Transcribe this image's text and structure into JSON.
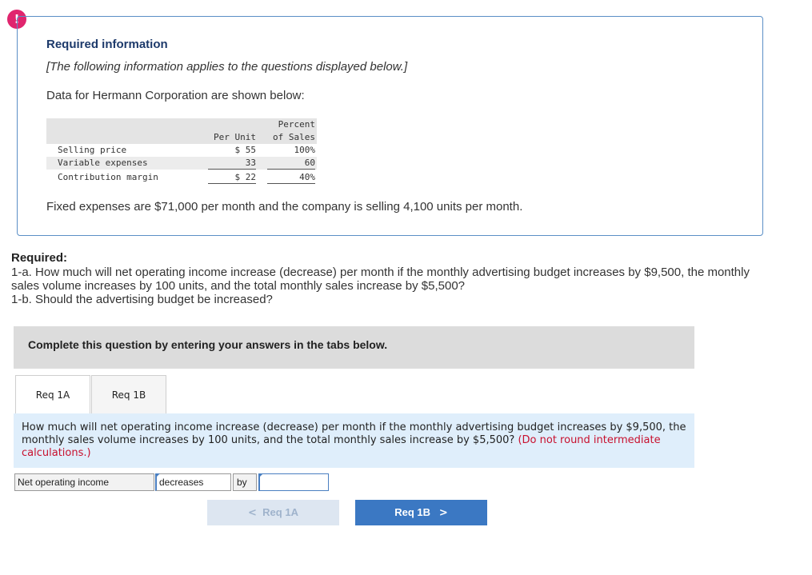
{
  "alert": {
    "symbol": "!"
  },
  "info": {
    "title": "Required information",
    "note": "[The following information applies to the questions displayed below.]",
    "intro": "Data for Hermann Corporation are shown below:",
    "fixed": "Fixed expenses are $71,000 per month and the company is selling 4,100 units per month."
  },
  "table": {
    "header_pu": "Per Unit",
    "header_pct_1": "Percent",
    "header_pct_2": "of Sales",
    "rows": [
      {
        "label": "Selling price",
        "per_unit": "$ 55",
        "percent": "100%"
      },
      {
        "label": "Variable expenses",
        "per_unit": "33",
        "percent": "60"
      },
      {
        "label": "Contribution margin",
        "per_unit": "$ 22",
        "percent": "40%"
      }
    ]
  },
  "required": {
    "heading": "Required:",
    "line1": "1-a. How much will net operating income increase (decrease) per month if the monthly advertising budget increases by $9,500, the monthly sales volume increases by 100 units, and the total monthly sales increase by $5,500?",
    "line2": "1-b. Should the advertising budget be increased?"
  },
  "complete": {
    "text": "Complete this question by entering your answers in the tabs below."
  },
  "tabs": [
    {
      "label": "Req 1A"
    },
    {
      "label": "Req 1B"
    }
  ],
  "question": {
    "text": "How much will net operating income increase (decrease) per month if the monthly advertising budget increases by $9,500, the monthly sales volume increases by 100 units, and the total monthly sales increase by $5,500?",
    "note": "(Do not round intermediate calculations.)"
  },
  "answer": {
    "label": "Net operating income",
    "direction": "decreases",
    "by": "by",
    "value": ""
  },
  "nav": {
    "prev_label": "Req 1A",
    "next_label": "Req 1B",
    "prev_glyph": "<",
    "next_glyph": ">"
  },
  "colors": {
    "accent": "#3b78c3",
    "alert": "#e0256e",
    "question_bg": "#dfeefb",
    "note_red": "#c8102e"
  }
}
